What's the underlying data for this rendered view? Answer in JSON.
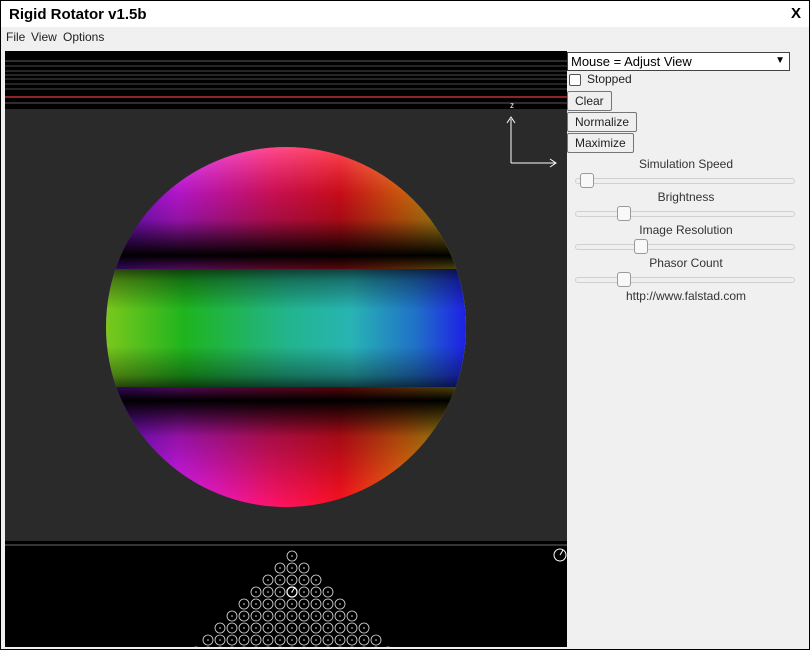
{
  "window": {
    "title": "Rigid Rotator v1.5b",
    "close_label": "X"
  },
  "menu": [
    "File",
    "View",
    "Options"
  ],
  "controls": {
    "mouse_mode": "Mouse = Adjust View",
    "stopped_label": "Stopped",
    "stopped_checked": false,
    "buttons": [
      "Clear",
      "Normalize",
      "Maximize"
    ],
    "sliders": [
      {
        "label": "Simulation Speed",
        "value": 0.02
      },
      {
        "label": "Brightness",
        "value": 0.2
      },
      {
        "label": "Image Resolution",
        "value": 0.28
      },
      {
        "label": "Phasor Count",
        "value": 0.2
      }
    ],
    "url": "http://www.falstad.com"
  },
  "axes": {
    "z_label": "z"
  },
  "colors": {
    "energy_level_line": "#c03030",
    "background": "#2a2a2a"
  },
  "phasor_rows": 9
}
